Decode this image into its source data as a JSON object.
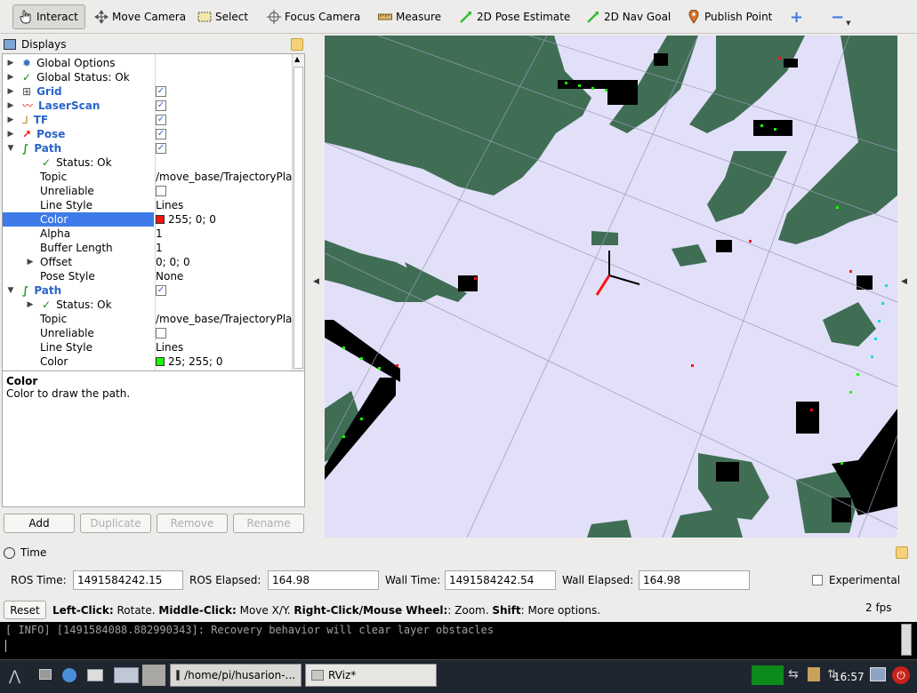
{
  "toolbar": {
    "interact": "Interact",
    "move_camera": "Move Camera",
    "select": "Select",
    "focus_camera": "Focus Camera",
    "measure": "Measure",
    "pose_estimate": "2D Pose Estimate",
    "nav_goal": "2D Nav Goal",
    "publish_point": "Publish Point",
    "add": "+",
    "remove": "−"
  },
  "displays": {
    "title": "Displays",
    "rows": [
      {
        "label": "Global Options",
        "value": ""
      },
      {
        "label": "Global Status: Ok",
        "value": ""
      },
      {
        "label": "Grid",
        "value": "✓"
      },
      {
        "label": "LaserScan",
        "value": "✓"
      },
      {
        "label": "TF",
        "value": "✓"
      },
      {
        "label": "Pose",
        "value": "✓"
      },
      {
        "label": "Path",
        "value": "✓"
      },
      {
        "label": "Status: Ok",
        "value": ""
      },
      {
        "label": "Topic",
        "value": "/move_base/TrajectoryPla..."
      },
      {
        "label": "Unreliable",
        "value": ""
      },
      {
        "label": "Line Style",
        "value": "Lines"
      },
      {
        "label": "Color",
        "value": "255; 0; 0"
      },
      {
        "label": "Alpha",
        "value": "1"
      },
      {
        "label": "Buffer Length",
        "value": "1"
      },
      {
        "label": "Offset",
        "value": "0; 0; 0"
      },
      {
        "label": "Pose Style",
        "value": "None"
      },
      {
        "label": "Path",
        "value": "✓"
      },
      {
        "label": "Status: Ok",
        "value": ""
      },
      {
        "label": "Topic",
        "value": "/move_base/TrajectoryPla..."
      },
      {
        "label": "Unreliable",
        "value": ""
      },
      {
        "label": "Line Style",
        "value": "Lines"
      },
      {
        "label": "Color",
        "value": "25; 255; 0"
      }
    ],
    "desc_title": "Color",
    "desc_text": "Color to draw the path.",
    "buttons": {
      "add": "Add",
      "duplicate": "Duplicate",
      "remove": "Remove",
      "rename": "Rename"
    }
  },
  "colors": {
    "path1": "#ff1010",
    "path2": "#19ff00",
    "selection": "#3e7ae8",
    "map_free": "#e2dff8",
    "map_occupied": "#000000",
    "map_unknown": "#3f6e55"
  },
  "time": {
    "title": "Time",
    "ros_time_label": "ROS Time:",
    "ros_time": "1491584242.15",
    "ros_elapsed_label": "ROS Elapsed:",
    "ros_elapsed": "164.98",
    "wall_time_label": "Wall Time:",
    "wall_time": "1491584242.54",
    "wall_elapsed_label": "Wall Elapsed:",
    "wall_elapsed": "164.98",
    "experimental": "Experimental",
    "reset": "Reset",
    "hint_left_b": "Left-Click:",
    "hint_left": " Rotate. ",
    "hint_mid_b": "Middle-Click:",
    "hint_mid": " Move X/Y. ",
    "hint_right_b": "Right-Click/Mouse Wheel:",
    "hint_right": ": Zoom. ",
    "hint_shift_b": "Shift",
    "hint_shift": ": More options.",
    "fps": "2 fps"
  },
  "console": {
    "line": "[ INFO] [1491584088.882990343]: Recovery behavior will clear layer obstacles"
  },
  "taskbar": {
    "terminal": "/home/pi/husarion-...",
    "rviz": "RViz*",
    "clock": "16:57"
  }
}
